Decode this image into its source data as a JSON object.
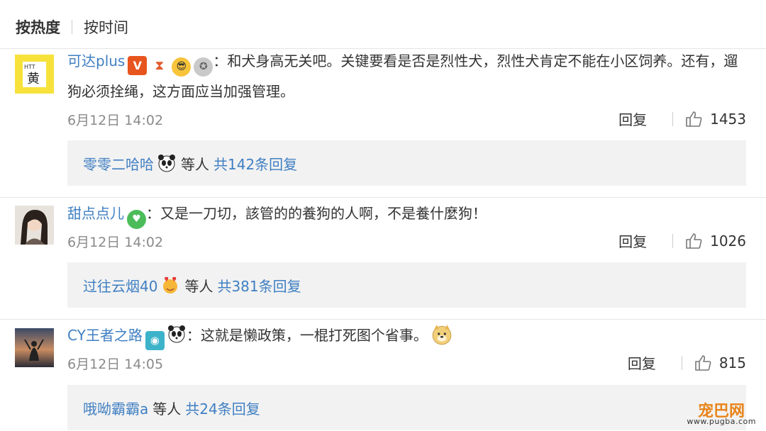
{
  "tabs": {
    "hot": "按热度",
    "time": "按时间"
  },
  "comments": [
    {
      "username": "可达plus",
      "text": "：和犬身高无关吧。关键要看是否是烈性犬，烈性犬肯定不能在小区饲养。还有，遛狗必须拴绳，这方面应当加强管理。",
      "date": "6月12日 14:02",
      "reply_label": "回复",
      "likes": "1453",
      "badges": [
        "v-badge-icon",
        "hourglass-icon",
        "cool-cat-icon",
        "medal-icon"
      ],
      "replies_preview": {
        "user": "零零二哈哈",
        "mid": "等人",
        "count_text": "共142条回复"
      }
    },
    {
      "username": "甜点点儿",
      "text": "：又是一刀切，該管的的養狗的人啊，不是養什麼狗！",
      "date": "6月12日 14:02",
      "reply_label": "回复",
      "likes": "1026",
      "badges": [
        "green-heart-icon"
      ],
      "replies_preview": {
        "user": "过往云烟40",
        "mid": "等人",
        "count_text": "共381条回复"
      }
    },
    {
      "username": "CY王者之路",
      "text": "：这就是懒政策，一棍打死图个省事。",
      "date": "6月12日 14:05",
      "reply_label": "回复",
      "likes": "815",
      "badges": [
        "camera-icon",
        "panda-icon"
      ],
      "replies_preview": {
        "user": "哦呦霸霸a",
        "mid": "等人",
        "count_text": "共24条回复"
      }
    }
  ],
  "watermark": {
    "logo": "宠巴网",
    "url": "www.pugba.com"
  },
  "colors": {
    "link": "#3f7fc2",
    "muted": "#8a8a8a",
    "reply_bg": "#f2f2f2",
    "accent": "#e8841a"
  }
}
